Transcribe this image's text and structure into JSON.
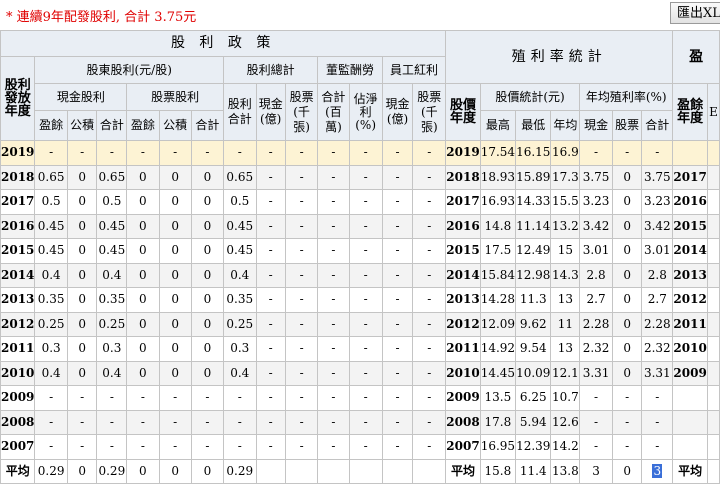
{
  "title": "* 連續9年配發股利, 合計 3.75元",
  "export_label": "匯出XLS",
  "headers": {
    "dividend_policy": "股 利 政 策",
    "yield_stats": "殖利率統計",
    "truncated_right": "盈",
    "dividend_year": "股利發放年度",
    "shareholder_div": "股東股利(元/股)",
    "div_total_group": "股利總計",
    "supervisor_pay": "董監酬勞",
    "employee_bonus": "員工紅利",
    "cash_div": "現金股利",
    "stock_div": "股票股利",
    "div_total": "股利合計",
    "from_earnings": "盈餘",
    "from_reserve": "公積",
    "subtotal": "合計",
    "cash_yi": "現金(億)",
    "stock_k": "股票(千張)",
    "total_mil": "合計(百萬)",
    "pct_net_profit": "佔淨利(%)",
    "emp_cash_yi": "現金(億)",
    "emp_stock_k": "股票(千張)",
    "stock_year": "股價年度",
    "price_stats": "股價統計(元)",
    "avg_yield": "年均殖利率(%)",
    "high": "最高",
    "low": "最低",
    "year_avg": "年均",
    "cash": "現金",
    "stock": "股票",
    "total": "合計",
    "earnings_year": "盈餘年度",
    "truncated_e": "E"
  },
  "rows": [
    {
      "year": "2019",
      "c_earn": "-",
      "c_res": "-",
      "c_sum": "-",
      "s_earn": "-",
      "s_res": "-",
      "s_sum": "-",
      "d_total": "-",
      "t_cash": "-",
      "t_stock": "-",
      "sup_total": "-",
      "sup_pct": "-",
      "emp_cash": "-",
      "emp_stock": "-",
      "py": "2019",
      "hi": "17.54",
      "lo": "16.15",
      "avg": "16.9",
      "y_cash": "-",
      "y_stock": "-",
      "y_total": "-",
      "ey": ""
    },
    {
      "year": "2018",
      "c_earn": "0.65",
      "c_res": "0",
      "c_sum": "0.65",
      "s_earn": "0",
      "s_res": "0",
      "s_sum": "0",
      "d_total": "0.65",
      "t_cash": "-",
      "t_stock": "-",
      "sup_total": "-",
      "sup_pct": "-",
      "emp_cash": "-",
      "emp_stock": "-",
      "py": "2018",
      "hi": "18.93",
      "lo": "15.89",
      "avg": "17.3",
      "y_cash": "3.75",
      "y_stock": "0",
      "y_total": "3.75",
      "ey": "2017"
    },
    {
      "year": "2017",
      "c_earn": "0.5",
      "c_res": "0",
      "c_sum": "0.5",
      "s_earn": "0",
      "s_res": "0",
      "s_sum": "0",
      "d_total": "0.5",
      "t_cash": "-",
      "t_stock": "-",
      "sup_total": "-",
      "sup_pct": "-",
      "emp_cash": "-",
      "emp_stock": "-",
      "py": "2017",
      "hi": "16.93",
      "lo": "14.33",
      "avg": "15.5",
      "y_cash": "3.23",
      "y_stock": "0",
      "y_total": "3.23",
      "ey": "2016"
    },
    {
      "year": "2016",
      "c_earn": "0.45",
      "c_res": "0",
      "c_sum": "0.45",
      "s_earn": "0",
      "s_res": "0",
      "s_sum": "0",
      "d_total": "0.45",
      "t_cash": "-",
      "t_stock": "-",
      "sup_total": "-",
      "sup_pct": "-",
      "emp_cash": "-",
      "emp_stock": "-",
      "py": "2016",
      "hi": "14.8",
      "lo": "11.14",
      "avg": "13.2",
      "y_cash": "3.42",
      "y_stock": "0",
      "y_total": "3.42",
      "ey": "2015"
    },
    {
      "year": "2015",
      "c_earn": "0.45",
      "c_res": "0",
      "c_sum": "0.45",
      "s_earn": "0",
      "s_res": "0",
      "s_sum": "0",
      "d_total": "0.45",
      "t_cash": "-",
      "t_stock": "-",
      "sup_total": "-",
      "sup_pct": "-",
      "emp_cash": "-",
      "emp_stock": "-",
      "py": "2015",
      "hi": "17.5",
      "lo": "12.49",
      "avg": "15",
      "y_cash": "3.01",
      "y_stock": "0",
      "y_total": "3.01",
      "ey": "2014"
    },
    {
      "year": "2014",
      "c_earn": "0.4",
      "c_res": "0",
      "c_sum": "0.4",
      "s_earn": "0",
      "s_res": "0",
      "s_sum": "0",
      "d_total": "0.4",
      "t_cash": "-",
      "t_stock": "-",
      "sup_total": "-",
      "sup_pct": "-",
      "emp_cash": "-",
      "emp_stock": "-",
      "py": "2014",
      "hi": "15.84",
      "lo": "12.98",
      "avg": "14.3",
      "y_cash": "2.8",
      "y_stock": "0",
      "y_total": "2.8",
      "ey": "2013"
    },
    {
      "year": "2013",
      "c_earn": "0.35",
      "c_res": "0",
      "c_sum": "0.35",
      "s_earn": "0",
      "s_res": "0",
      "s_sum": "0",
      "d_total": "0.35",
      "t_cash": "-",
      "t_stock": "-",
      "sup_total": "-",
      "sup_pct": "-",
      "emp_cash": "-",
      "emp_stock": "-",
      "py": "2013",
      "hi": "14.28",
      "lo": "11.3",
      "avg": "13",
      "y_cash": "2.7",
      "y_stock": "0",
      "y_total": "2.7",
      "ey": "2012"
    },
    {
      "year": "2012",
      "c_earn": "0.25",
      "c_res": "0",
      "c_sum": "0.25",
      "s_earn": "0",
      "s_res": "0",
      "s_sum": "0",
      "d_total": "0.25",
      "t_cash": "-",
      "t_stock": "-",
      "sup_total": "-",
      "sup_pct": "-",
      "emp_cash": "-",
      "emp_stock": "-",
      "py": "2012",
      "hi": "12.09",
      "lo": "9.62",
      "avg": "11",
      "y_cash": "2.28",
      "y_stock": "0",
      "y_total": "2.28",
      "ey": "2011"
    },
    {
      "year": "2011",
      "c_earn": "0.3",
      "c_res": "0",
      "c_sum": "0.3",
      "s_earn": "0",
      "s_res": "0",
      "s_sum": "0",
      "d_total": "0.3",
      "t_cash": "-",
      "t_stock": "-",
      "sup_total": "-",
      "sup_pct": "-",
      "emp_cash": "-",
      "emp_stock": "-",
      "py": "2011",
      "hi": "14.92",
      "lo": "9.54",
      "avg": "13",
      "y_cash": "2.32",
      "y_stock": "0",
      "y_total": "2.32",
      "ey": "2010"
    },
    {
      "year": "2010",
      "c_earn": "0.4",
      "c_res": "0",
      "c_sum": "0.4",
      "s_earn": "0",
      "s_res": "0",
      "s_sum": "0",
      "d_total": "0.4",
      "t_cash": "-",
      "t_stock": "-",
      "sup_total": "-",
      "sup_pct": "-",
      "emp_cash": "-",
      "emp_stock": "-",
      "py": "2010",
      "hi": "14.45",
      "lo": "10.09",
      "avg": "12.1",
      "y_cash": "3.31",
      "y_stock": "0",
      "y_total": "3.31",
      "ey": "2009"
    },
    {
      "year": "2009",
      "c_earn": "-",
      "c_res": "-",
      "c_sum": "-",
      "s_earn": "-",
      "s_res": "-",
      "s_sum": "-",
      "d_total": "-",
      "t_cash": "-",
      "t_stock": "-",
      "sup_total": "-",
      "sup_pct": "-",
      "emp_cash": "-",
      "emp_stock": "-",
      "py": "2009",
      "hi": "13.5",
      "lo": "6.25",
      "avg": "10.7",
      "y_cash": "-",
      "y_stock": "-",
      "y_total": "-",
      "ey": ""
    },
    {
      "year": "2008",
      "c_earn": "-",
      "c_res": "-",
      "c_sum": "-",
      "s_earn": "-",
      "s_res": "-",
      "s_sum": "-",
      "d_total": "-",
      "t_cash": "-",
      "t_stock": "-",
      "sup_total": "-",
      "sup_pct": "-",
      "emp_cash": "-",
      "emp_stock": "-",
      "py": "2008",
      "hi": "17.8",
      "lo": "5.94",
      "avg": "12.6",
      "y_cash": "-",
      "y_stock": "-",
      "y_total": "-",
      "ey": ""
    },
    {
      "year": "2007",
      "c_earn": "-",
      "c_res": "-",
      "c_sum": "-",
      "s_earn": "-",
      "s_res": "-",
      "s_sum": "-",
      "d_total": "-",
      "t_cash": "-",
      "t_stock": "-",
      "sup_total": "-",
      "sup_pct": "-",
      "emp_cash": "-",
      "emp_stock": "-",
      "py": "2007",
      "hi": "16.95",
      "lo": "12.39",
      "avg": "14.2",
      "y_cash": "-",
      "y_stock": "-",
      "y_total": "-",
      "ey": ""
    }
  ],
  "average": {
    "label": "平均",
    "c_earn": "0.29",
    "c_res": "0",
    "c_sum": "0.29",
    "s_earn": "0",
    "s_res": "0",
    "s_sum": "0",
    "d_total": "0.29",
    "py_label": "平均",
    "hi": "15.8",
    "lo": "11.4",
    "avg": "13.8",
    "y_cash": "3",
    "y_stock": "0",
    "y_total": "3",
    "ey_label": "平均"
  }
}
